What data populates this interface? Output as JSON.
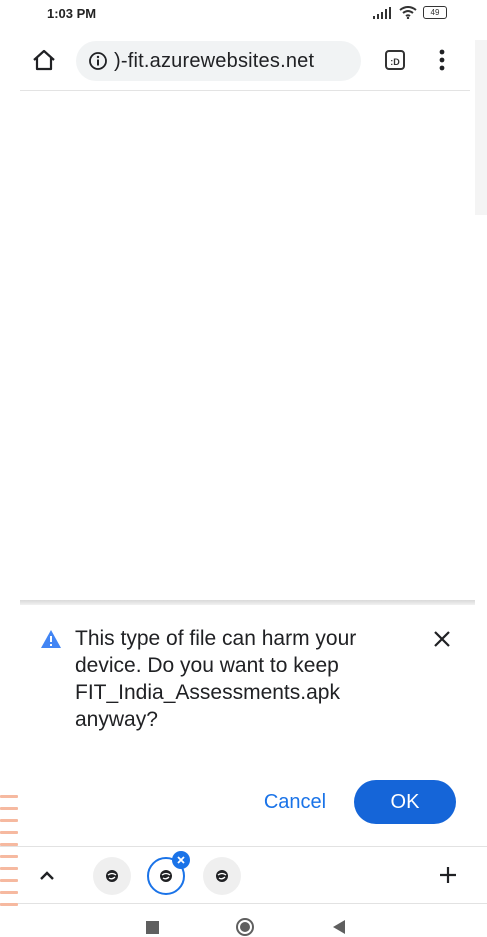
{
  "status_bar": {
    "time": "1:03 PM",
    "battery": "49"
  },
  "toolbar": {
    "url": ")-fit.azurewebsites.net",
    "tab_count": ":D"
  },
  "download_warning": {
    "message": "This type of file can harm your device. Do you want to keep FIT_India_Assessments.apk anyway?",
    "cancel_label": "Cancel",
    "ok_label": "OK"
  },
  "colors": {
    "accent": "#1a73e8",
    "ok_button": "#1565d8",
    "warning_icon": "#4285f4"
  },
  "icons": {
    "home": "home-icon",
    "info": "info-icon",
    "menu": "more-vert-icon",
    "warning": "warning-icon",
    "close": "close-icon",
    "chevron": "chevron-up-icon",
    "tab_favicon": "globe-icon",
    "plus": "plus-icon"
  }
}
